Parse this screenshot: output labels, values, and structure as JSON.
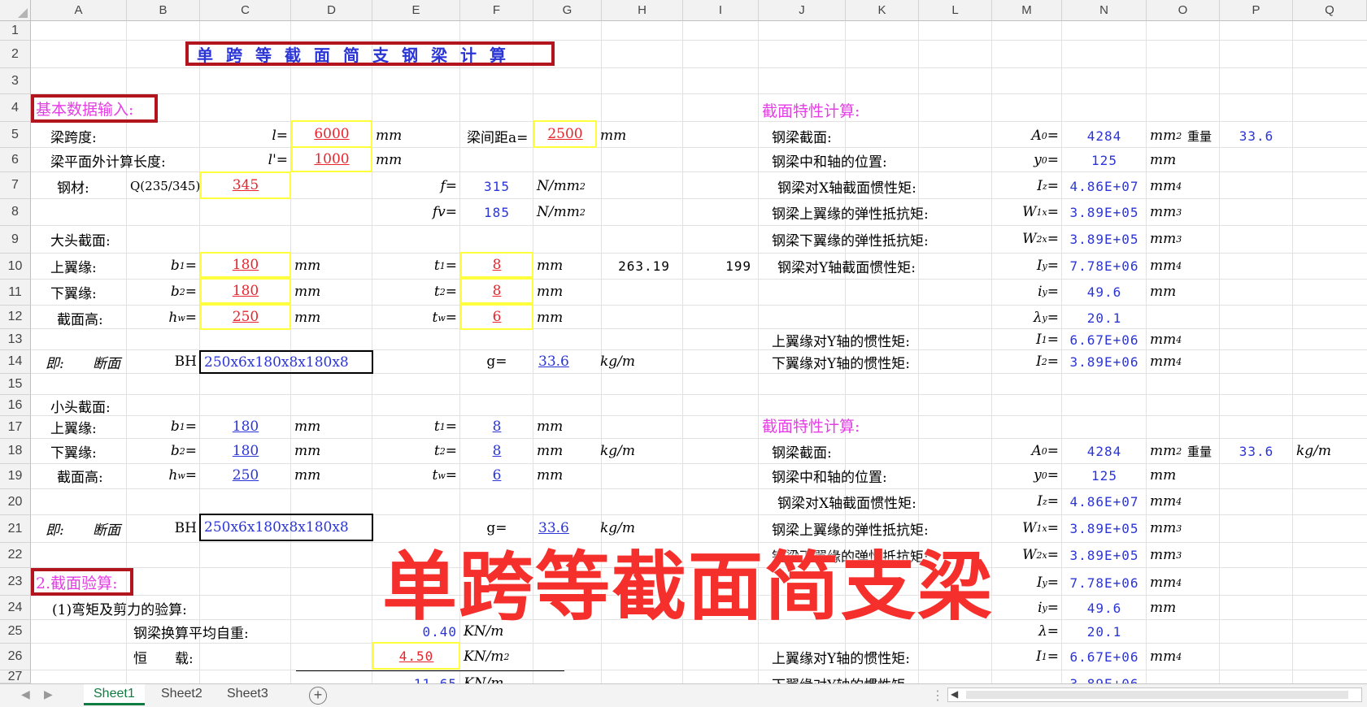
{
  "columns": [
    "A",
    "B",
    "C",
    "D",
    "E",
    "F",
    "G",
    "H",
    "I",
    "J",
    "K",
    "L",
    "M",
    "N",
    "O",
    "P",
    "Q"
  ],
  "rows": [
    "1",
    "2",
    "3",
    "4",
    "5",
    "6",
    "7",
    "8",
    "9",
    "10",
    "11",
    "12",
    "13",
    "14",
    "15",
    "16",
    "17",
    "18",
    "19",
    "20",
    "21",
    "22",
    "23",
    "24",
    "25",
    "26",
    "27"
  ],
  "title": "单跨等截面简支钢梁计算",
  "input": {
    "heading": "基本数据输入:",
    "span_label": "梁跨度:",
    "span_sym": "l=",
    "span_val": "6000",
    "unit_mm": "mm",
    "spacing_label": "梁间距a=",
    "spacing_val": "2500",
    "out_label": "梁平面外计算长度:",
    "out_sym": "l'=",
    "out_val": "1000",
    "steel_label": "钢材:",
    "steel_grade": "Q(235/345)",
    "steel_val": "345",
    "f_sym": "f=",
    "f_val": "315",
    "fv_sym": "fv=",
    "fv_val": "185",
    "stress_unit": "N/mm",
    "big_label": "大头截面:",
    "top_flange": "上翼缘:",
    "bottom_flange": "下翼缘:",
    "section_height": "截面高:",
    "b1": "b",
    "b1_sub": "1",
    "b2_sub": "2",
    "hw": "h",
    "hw_sub": "w",
    "t": "t",
    "t1_sub": "1",
    "t2_sub": "2",
    "tw_sub": "w",
    "eq": "=",
    "big_b1": "180",
    "big_b2": "180",
    "big_hw": "250",
    "big_t1": "8",
    "big_t2": "8",
    "big_tw": "6",
    "h10": "263.19",
    "i10": "199",
    "ji": "即:",
    "duanmian": "断面",
    "bh": "BH",
    "big_section": "250x6x180x8x180x8",
    "g_sym": "g=",
    "g_val": "33.6",
    "g_unit": "kg/m",
    "small_label": "小头截面:",
    "small_b1": "180",
    "small_b2": "180",
    "small_hw": "250",
    "small_t1": "8",
    "small_t2": "8",
    "small_tw": "6",
    "small_section": "250x6x180x8x180x8",
    "small_g_val": "33.6"
  },
  "check": {
    "heading": "2.截面验算:",
    "sub1": "(1)弯矩及剪力的验算:",
    "self_weight_label": "钢梁换算平均自重:",
    "self_weight_val": "0.40",
    "self_weight_unit": "KN/m",
    "dead_label": "恒　　载:",
    "dead_val": "4.50",
    "dead_unit": "KN/m",
    "row27_val": "11.65",
    "row27_unit": "KN/m"
  },
  "props": {
    "heading": "截面特性计算:",
    "area_label": "钢梁截面:",
    "area_sym": "A",
    "area_sub": "0",
    "area_val": "4284",
    "area_unit": "mm",
    "weight_label": "重量",
    "weight_val": "33.6",
    "y0_label": "钢梁中和轴的位置:",
    "y0_sym": "y",
    "y0_sub": "0",
    "y0_val": "125",
    "ix_label": "钢梁对X轴截面惯性矩:",
    "ix_sym": "I",
    "ix_sub": "z",
    "ix_val": "4.86E+07",
    "w1_label": "钢梁上翼缘的弹性抵抗矩:",
    "w_sym": "W",
    "w1_sub": "1x",
    "w1_val": "3.89E+05",
    "w2_label": "钢梁下翼缘的弹性抵抗矩:",
    "w2_sub": "2x",
    "w2_val": "3.89E+05",
    "iy_label": "钢梁对Y轴截面惯性矩:",
    "iy_sub": "y",
    "iy_val": "7.78E+06",
    "ry_sym": "i",
    "ry_sub": "y",
    "ry_val": "49.6",
    "lam_sym": "λ",
    "lam_sub": "y",
    "lam_val": "20.1",
    "i1_label": "上翼缘对Y轴的惯性矩:",
    "i1_sub": "1",
    "i1_val": "6.67E+06",
    "i2_label": "下翼缘对Y轴的惯性矩:",
    "i2_sub": "2",
    "i2_val": "3.89E+06",
    "weight_unit": "kg/m"
  },
  "overlay_text": "单跨等截面简支梁",
  "sheets": [
    "Sheet1",
    "Sheet2",
    "Sheet3"
  ],
  "add_sheet": "+"
}
